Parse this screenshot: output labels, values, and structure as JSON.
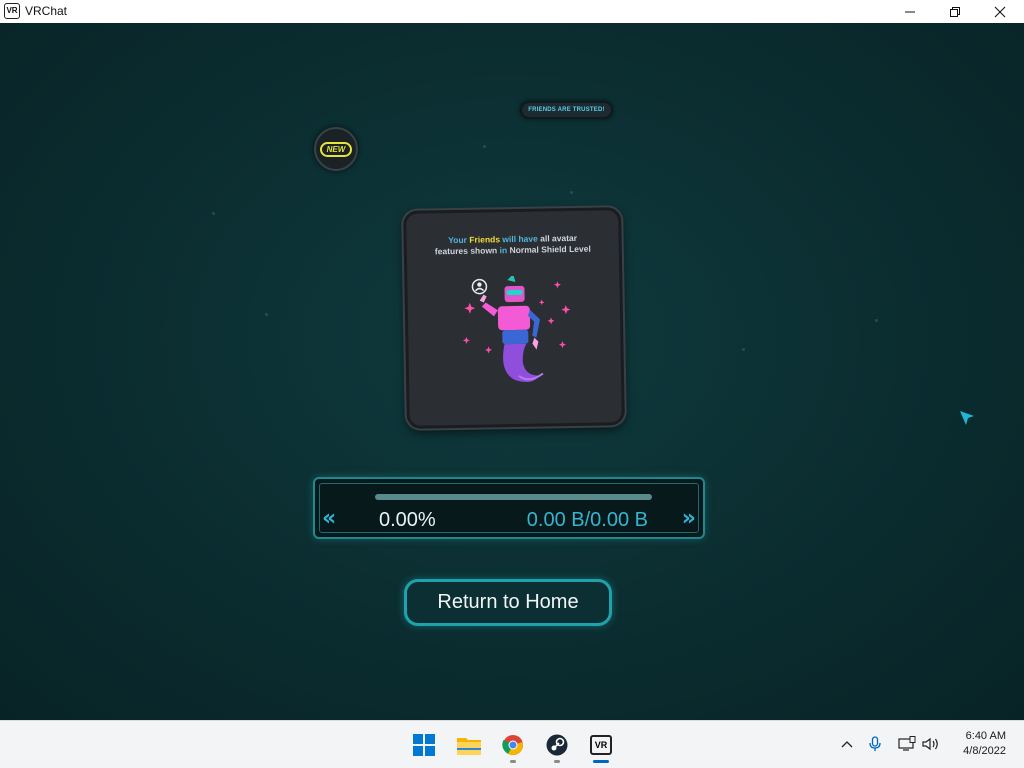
{
  "window": {
    "app_icon_text": "VR",
    "title": "VRChat",
    "controls": [
      "minimize-icon",
      "restore-icon",
      "close-icon"
    ]
  },
  "game": {
    "trusted_badge": "FRIENDS ARE TRUSTED!",
    "new_badge": "NEW",
    "card": {
      "line1_pre": "Your",
      "line1_highlight": "Friends",
      "line1_mid": "will have",
      "line1_post": "all avatar",
      "line2_pre": "features shown",
      "line2_mid": "in",
      "line2_post": "Normal Shield Level"
    },
    "download": {
      "progress": 0.0,
      "percent_text": "0.00%",
      "bytes_text": "0.00 B/0.00 B",
      "left_arrow": "«",
      "right_arrow": "»"
    },
    "home_button": "Return to Home"
  },
  "taskbar": {
    "apps": [
      {
        "name": "start-icon"
      },
      {
        "name": "file-explorer-icon"
      },
      {
        "name": "chrome-icon"
      },
      {
        "name": "steam-icon"
      },
      {
        "name": "vrchat-icon",
        "label": "VR",
        "active": true
      }
    ],
    "tray": [
      "chevron-up-icon",
      "microphone-icon",
      "display-icon",
      "speaker-icon"
    ],
    "time": "6:40 AM",
    "date": "4/8/2022"
  },
  "colors": {
    "background": "#0b2b2e",
    "accent": "#1ea3ad",
    "bytes_text": "#37b3d0",
    "highlight_yellow": "#f2df34",
    "taskbar": "#f3f4f6"
  }
}
